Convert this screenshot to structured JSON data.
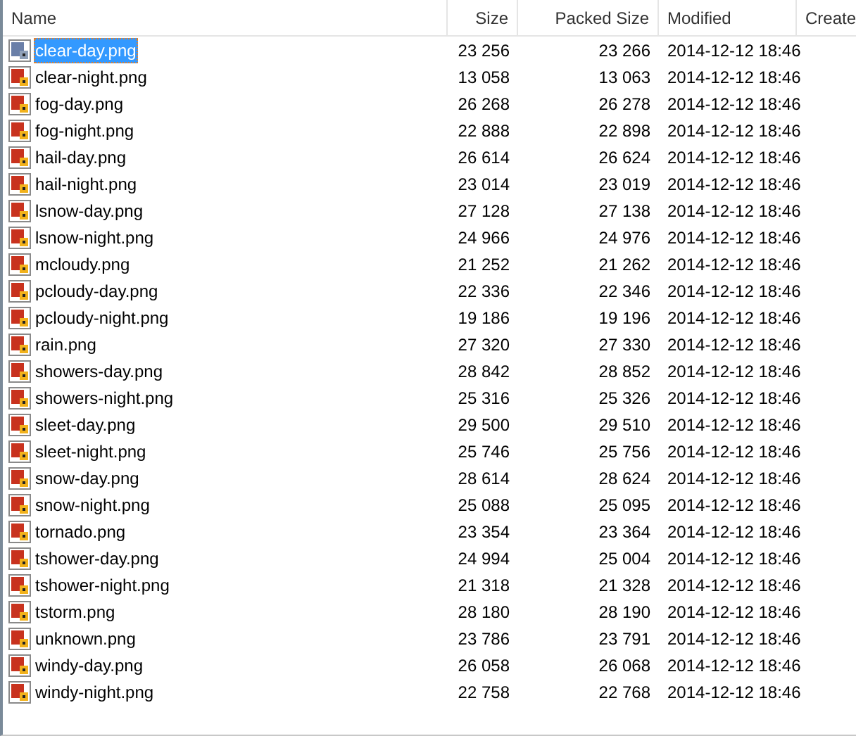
{
  "columns": [
    {
      "label": "Name"
    },
    {
      "label": "Size"
    },
    {
      "label": "Packed Size"
    },
    {
      "label": "Modified"
    },
    {
      "label": "Create"
    }
  ],
  "rows": [
    {
      "name": "clear-day.png",
      "size": "23 256",
      "packed": "23 266",
      "modified": "2014-12-12 18:46",
      "selected": true
    },
    {
      "name": "clear-night.png",
      "size": "13 058",
      "packed": "13 063",
      "modified": "2014-12-12 18:46",
      "selected": false
    },
    {
      "name": "fog-day.png",
      "size": "26 268",
      "packed": "26 278",
      "modified": "2014-12-12 18:46",
      "selected": false
    },
    {
      "name": "fog-night.png",
      "size": "22 888",
      "packed": "22 898",
      "modified": "2014-12-12 18:46",
      "selected": false
    },
    {
      "name": "hail-day.png",
      "size": "26 614",
      "packed": "26 624",
      "modified": "2014-12-12 18:46",
      "selected": false
    },
    {
      "name": "hail-night.png",
      "size": "23 014",
      "packed": "23 019",
      "modified": "2014-12-12 18:46",
      "selected": false
    },
    {
      "name": "lsnow-day.png",
      "size": "27 128",
      "packed": "27 138",
      "modified": "2014-12-12 18:46",
      "selected": false
    },
    {
      "name": "lsnow-night.png",
      "size": "24 966",
      "packed": "24 976",
      "modified": "2014-12-12 18:46",
      "selected": false
    },
    {
      "name": "mcloudy.png",
      "size": "21 252",
      "packed": "21 262",
      "modified": "2014-12-12 18:46",
      "selected": false
    },
    {
      "name": "pcloudy-day.png",
      "size": "22 336",
      "packed": "22 346",
      "modified": "2014-12-12 18:46",
      "selected": false
    },
    {
      "name": "pcloudy-night.png",
      "size": "19 186",
      "packed": "19 196",
      "modified": "2014-12-12 18:46",
      "selected": false
    },
    {
      "name": "rain.png",
      "size": "27 320",
      "packed": "27 330",
      "modified": "2014-12-12 18:46",
      "selected": false
    },
    {
      "name": "showers-day.png",
      "size": "28 842",
      "packed": "28 852",
      "modified": "2014-12-12 18:46",
      "selected": false
    },
    {
      "name": "showers-night.png",
      "size": "25 316",
      "packed": "25 326",
      "modified": "2014-12-12 18:46",
      "selected": false
    },
    {
      "name": "sleet-day.png",
      "size": "29 500",
      "packed": "29 510",
      "modified": "2014-12-12 18:46",
      "selected": false
    },
    {
      "name": "sleet-night.png",
      "size": "25 746",
      "packed": "25 756",
      "modified": "2014-12-12 18:46",
      "selected": false
    },
    {
      "name": "snow-day.png",
      "size": "28 614",
      "packed": "28 624",
      "modified": "2014-12-12 18:46",
      "selected": false
    },
    {
      "name": "snow-night.png",
      "size": "25 088",
      "packed": "25 095",
      "modified": "2014-12-12 18:46",
      "selected": false
    },
    {
      "name": "tornado.png",
      "size": "23 354",
      "packed": "23 364",
      "modified": "2014-12-12 18:46",
      "selected": false
    },
    {
      "name": "tshower-day.png",
      "size": "24 994",
      "packed": "25 004",
      "modified": "2014-12-12 18:46",
      "selected": false
    },
    {
      "name": "tshower-night.png",
      "size": "21 318",
      "packed": "21 328",
      "modified": "2014-12-12 18:46",
      "selected": false
    },
    {
      "name": "tstorm.png",
      "size": "28 180",
      "packed": "28 190",
      "modified": "2014-12-12 18:46",
      "selected": false
    },
    {
      "name": "unknown.png",
      "size": "23 786",
      "packed": "23 791",
      "modified": "2014-12-12 18:46",
      "selected": false
    },
    {
      "name": "windy-day.png",
      "size": "26 058",
      "packed": "26 068",
      "modified": "2014-12-12 18:46",
      "selected": false
    },
    {
      "name": "windy-night.png",
      "size": "22 758",
      "packed": "22 768",
      "modified": "2014-12-12 18:46",
      "selected": false
    }
  ]
}
